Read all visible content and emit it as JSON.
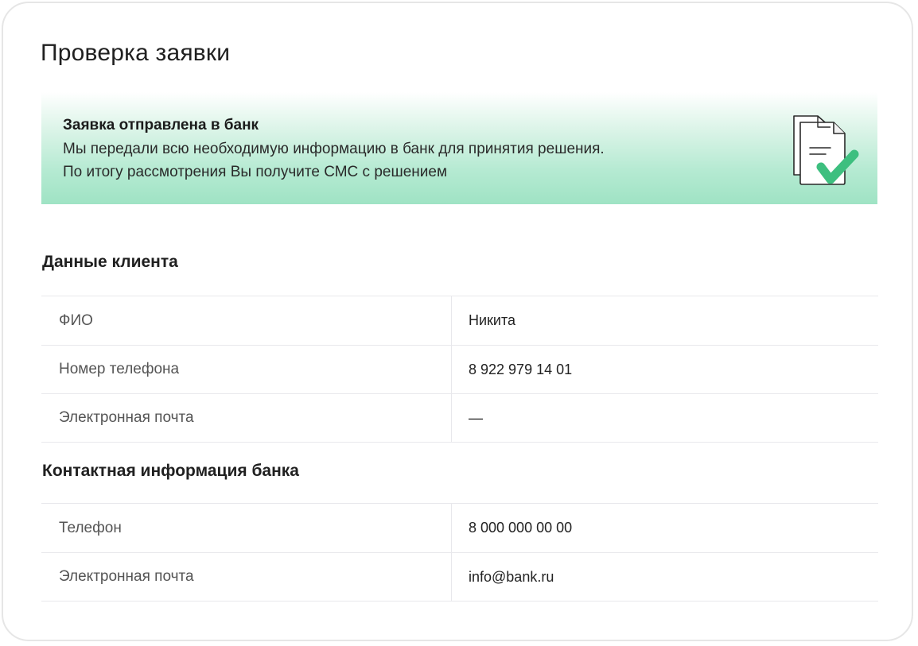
{
  "page": {
    "title": "Проверка заявки"
  },
  "banner": {
    "title": "Заявка отправлена в банк",
    "line1": "Мы передали всю необходимую информацию в банк для принятия решения.",
    "line2": "По итогу рассмотрения Вы получите СМС с решением",
    "illustration_icon": "document-check-icon",
    "gradient_colors": [
      "#ffffff",
      "#9fe3c4"
    ],
    "check_color": "#3dbf7f"
  },
  "client": {
    "section_title": "Данные клиента",
    "rows": [
      {
        "label": "ФИО",
        "value": "Никита"
      },
      {
        "label": "Номер телефона",
        "value": "8 922 979 14 01"
      },
      {
        "label": "Электронная почта",
        "value": "—"
      }
    ]
  },
  "bank": {
    "section_title": "Контактная информация банка",
    "rows": [
      {
        "label": "Телефон",
        "value": "8 000 000 00 00"
      },
      {
        "label": "Электронная почта",
        "value": "info@bank.ru"
      }
    ]
  }
}
